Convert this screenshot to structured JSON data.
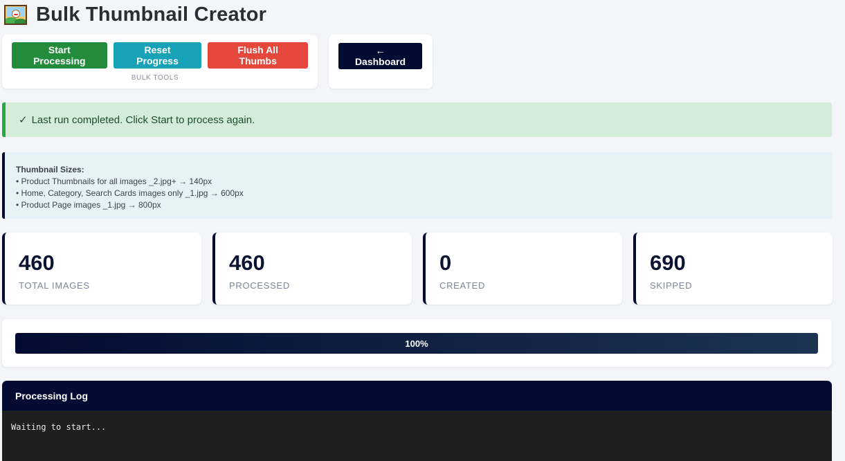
{
  "header": {
    "title": "Bulk Thumbnail Creator",
    "icon": "framed-picture-icon"
  },
  "toolbar": {
    "start_label": "Start Processing",
    "reset_label": "Reset Progress",
    "flush_label": "Flush All Thumbs",
    "caption": "BULK TOOLS",
    "dashboard_label": "← Dashboard",
    "colors": {
      "start": "#238b3c",
      "reset": "#17a2b8",
      "flush": "#e4483d",
      "dashboard": "#040b32"
    }
  },
  "alert": {
    "icon": "✓",
    "message": "Last run completed. Click Start to process again."
  },
  "info": {
    "title": "Thumbnail Sizes:",
    "lines": [
      "• Product Thumbnails for all images _2.jpg+ → 140px",
      "• Home, Category, Search Cards images only _1.jpg → 600px",
      "• Product Page images _1.jpg → 800px"
    ]
  },
  "stats": [
    {
      "value": "460",
      "label": "TOTAL IMAGES"
    },
    {
      "value": "460",
      "label": "PROCESSED"
    },
    {
      "value": "0",
      "label": "CREATED"
    },
    {
      "value": "690",
      "label": "SKIPPED"
    }
  ],
  "progress": {
    "percent": 100,
    "label": "100%"
  },
  "log": {
    "title": "Processing Log",
    "lines": [
      "Waiting to start..."
    ]
  }
}
